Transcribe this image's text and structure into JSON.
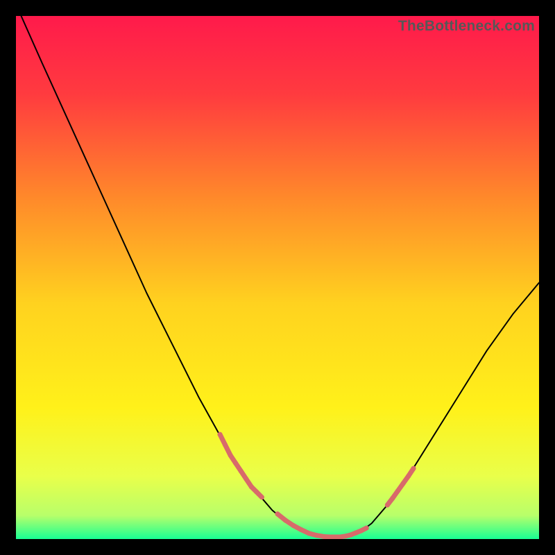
{
  "watermark": "TheBottleneck.com",
  "chart_data": {
    "type": "line",
    "title": "",
    "xlabel": "",
    "ylabel": "",
    "xlim": [
      0,
      100
    ],
    "ylim": [
      0,
      100
    ],
    "grid": false,
    "legend": false,
    "gradient_stops": [
      {
        "offset": 0.0,
        "color": "#ff1a4b"
      },
      {
        "offset": 0.15,
        "color": "#ff3b3f"
      },
      {
        "offset": 0.35,
        "color": "#ff8a2a"
      },
      {
        "offset": 0.55,
        "color": "#ffd21f"
      },
      {
        "offset": 0.75,
        "color": "#fff11a"
      },
      {
        "offset": 0.88,
        "color": "#e9ff4a"
      },
      {
        "offset": 0.955,
        "color": "#b8ff6a"
      },
      {
        "offset": 1.0,
        "color": "#18ff94"
      }
    ],
    "series": [
      {
        "name": "bottleneck-curve",
        "color": "#000000",
        "stroke_width": 2,
        "x": [
          1,
          5,
          10,
          15,
          20,
          25,
          30,
          35,
          40,
          43,
          46,
          49,
          52,
          55,
          58,
          60,
          62,
          64,
          66,
          68,
          71,
          75,
          80,
          85,
          90,
          95,
          100
        ],
        "y": [
          100,
          91,
          80,
          69,
          58,
          47,
          37,
          27,
          18,
          13,
          9,
          5.5,
          3,
          1.5,
          0.7,
          0.4,
          0.4,
          0.7,
          1.5,
          3,
          6.5,
          12,
          20,
          28,
          36,
          43,
          49
        ]
      },
      {
        "name": "highlight-left",
        "color": "#d86a6a",
        "stroke_width": 7,
        "style": "dotted",
        "x": [
          39,
          40,
          41,
          42,
          43,
          44,
          45,
          46,
          47
        ],
        "y": [
          20,
          18,
          16,
          14.5,
          13,
          11.5,
          10,
          9,
          8
        ]
      },
      {
        "name": "highlight-bottom",
        "color": "#d86a6a",
        "stroke_width": 7,
        "style": "dotted",
        "x": [
          50,
          51.5,
          53,
          54.5,
          56,
          57.5,
          59,
          60,
          61,
          62,
          63,
          64,
          65,
          66,
          67
        ],
        "y": [
          4.8,
          3.6,
          2.6,
          1.8,
          1.1,
          0.7,
          0.45,
          0.4,
          0.4,
          0.4,
          0.55,
          0.8,
          1.2,
          1.6,
          2.1
        ]
      },
      {
        "name": "highlight-right",
        "color": "#d86a6a",
        "stroke_width": 7,
        "style": "dotted",
        "x": [
          71,
          72,
          73,
          74,
          75,
          76
        ],
        "y": [
          6.5,
          7.8,
          9.2,
          10.6,
          12,
          13.5
        ]
      }
    ]
  }
}
